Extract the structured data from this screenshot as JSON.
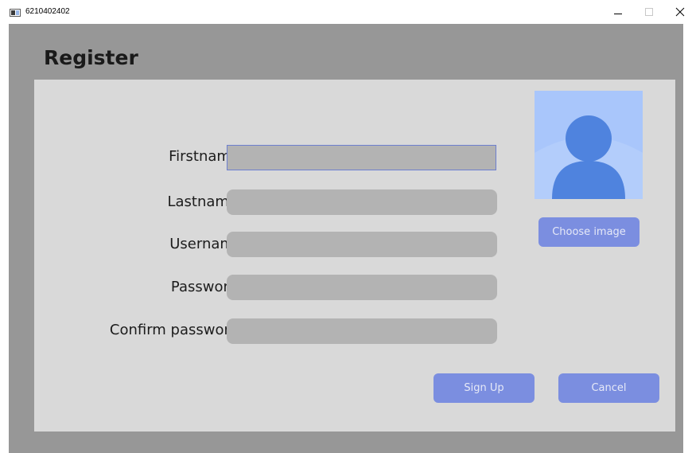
{
  "window": {
    "title": "6210402402",
    "icons": {
      "app": "app-window-icon",
      "minimize": "minimize-icon",
      "maximize": "maximize-icon",
      "close": "close-icon"
    }
  },
  "page": {
    "title": "Register"
  },
  "form": {
    "fields": [
      {
        "label": "Firstname",
        "value": "",
        "placeholder": ""
      },
      {
        "label": "Lastname",
        "value": "",
        "placeholder": ""
      },
      {
        "label": "Username",
        "value": "",
        "placeholder": ""
      },
      {
        "label": "Password",
        "value": "",
        "placeholder": ""
      },
      {
        "label": "Confirm password",
        "value": "",
        "placeholder": ""
      }
    ]
  },
  "profile": {
    "avatar_icon": "user-avatar-icon",
    "choose_image_label": "Choose image"
  },
  "actions": {
    "signup_label": "Sign Up",
    "cancel_label": "Cancel"
  },
  "colors": {
    "background": "#979797",
    "panel": "#d9d9d9",
    "input": "#b3b3b3",
    "input_focus_border": "#6d7fcf",
    "button": "#7b8ee0",
    "button_text": "#e6e9f7",
    "avatar_bg": "#a9c6fb",
    "avatar_figure": "#4f83de"
  }
}
